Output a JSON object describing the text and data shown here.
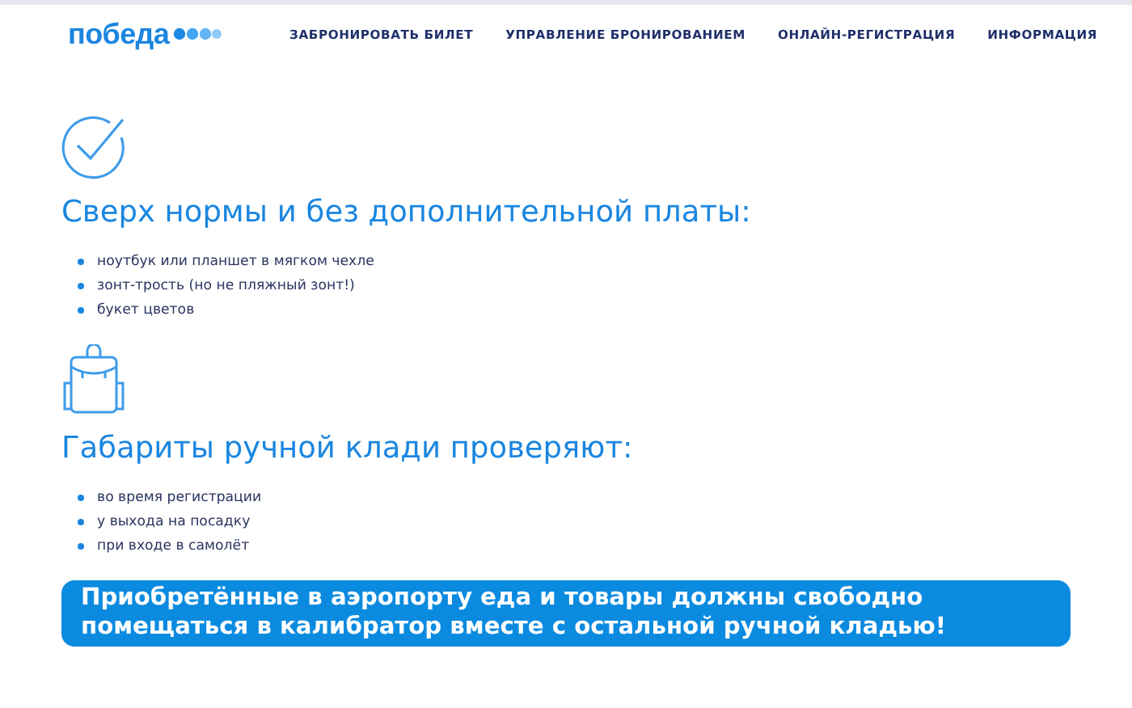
{
  "header": {
    "logo": "победа",
    "nav": [
      "ЗАБРОНИРОВАТЬ БИЛЕТ",
      "УПРАВЛЕНИЕ БРОНИРОВАНИЕМ",
      "ОНЛАЙН-РЕГИСТРАЦИЯ",
      "ИНФОРМАЦИЯ"
    ]
  },
  "sections": [
    {
      "kind": "check",
      "title": "Сверх нормы и без дополнительной платы:",
      "items": [
        "ноутбук или планшет в мягком чехле",
        "зонт-трость (но не пляжный зонт!)",
        "букет цветов"
      ]
    },
    {
      "kind": "backpack",
      "title": "Габариты ручной клади проверяют:",
      "items": [
        "во время регистрации",
        "у выхода на посадку",
        "при входе в самолёт"
      ]
    }
  ],
  "notice": "Приобретённые в аэропорту еда и товары должны свободно помещаться в калибратор вместе с остальной ручной кладью!"
}
